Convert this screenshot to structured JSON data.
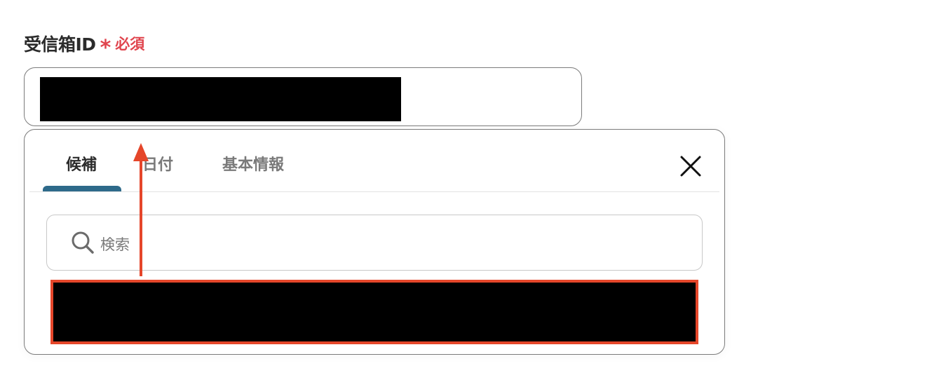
{
  "field": {
    "label": "受信箱ID",
    "required_mark": "*",
    "required_text": "必須"
  },
  "popup": {
    "tabs": [
      {
        "label": "候補",
        "active": true
      },
      {
        "label": "日付",
        "active": false
      },
      {
        "label": "基本情報",
        "active": false
      }
    ],
    "search": {
      "placeholder": "検索"
    }
  },
  "icons": {
    "search": "search-icon",
    "close": "close-icon",
    "annotation": "arrow-up-icon"
  },
  "colors": {
    "required": "#e0454e",
    "tab_indicator": "#2e6a8a",
    "highlight": "#e5462a"
  }
}
